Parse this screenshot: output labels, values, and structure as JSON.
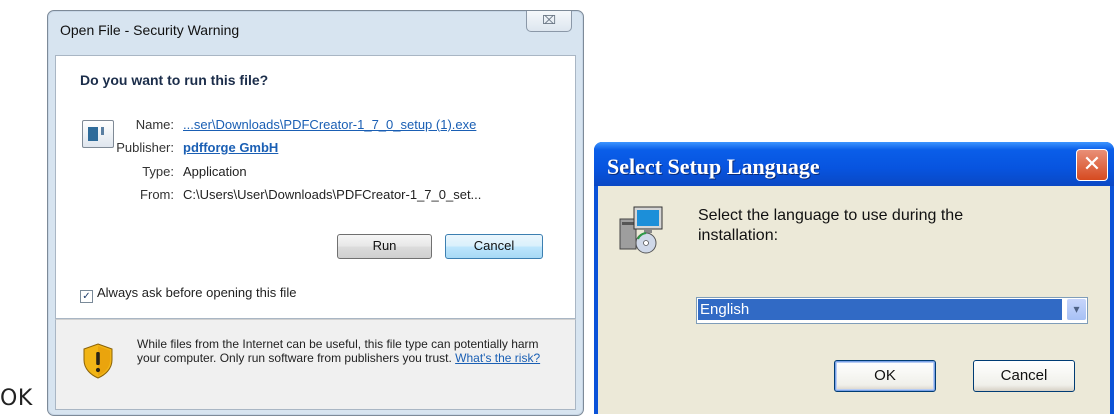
{
  "stray_caption": "OK",
  "security_warning": {
    "title": "Open File - Security Warning",
    "close_glyph": "⌧",
    "question": "Do you want to run this file?",
    "name_label": "Name:",
    "name_value": "...ser\\Downloads\\PDFCreator-1_7_0_setup (1).exe",
    "publisher_label": "Publisher:",
    "publisher_value": "pdfforge GmbH",
    "type_label": "Type:",
    "type_value": "Application",
    "from_label": "From:",
    "from_value": "C:\\Users\\User\\Downloads\\PDFCreator-1_7_0_set...",
    "run_button": "Run",
    "cancel_button": "Cancel",
    "always_ask_label": "Always ask before opening this file",
    "always_ask_checked": true,
    "check_glyph": "✓",
    "warning_text": "While files from the Internet can be useful, this file type can potentially harm your computer. Only run software from publishers you trust.",
    "risk_link": "What's the risk?",
    "icons": [
      "file-icon",
      "shield-warning-icon"
    ]
  },
  "setup_language": {
    "title": "Select Setup Language",
    "close_glyph": "✕",
    "message": "Select the language to use during the installation:",
    "selected_language": "English",
    "dropdown_glyph": "▾",
    "ok_button": "OK",
    "cancel_button": "Cancel",
    "colors": {
      "title_bar": "#0a5ee9",
      "body": "#ece9d8",
      "selection": "#316ac5"
    },
    "icons": [
      "setup-installer-icon",
      "close-icon",
      "dropdown-arrow-icon"
    ]
  }
}
